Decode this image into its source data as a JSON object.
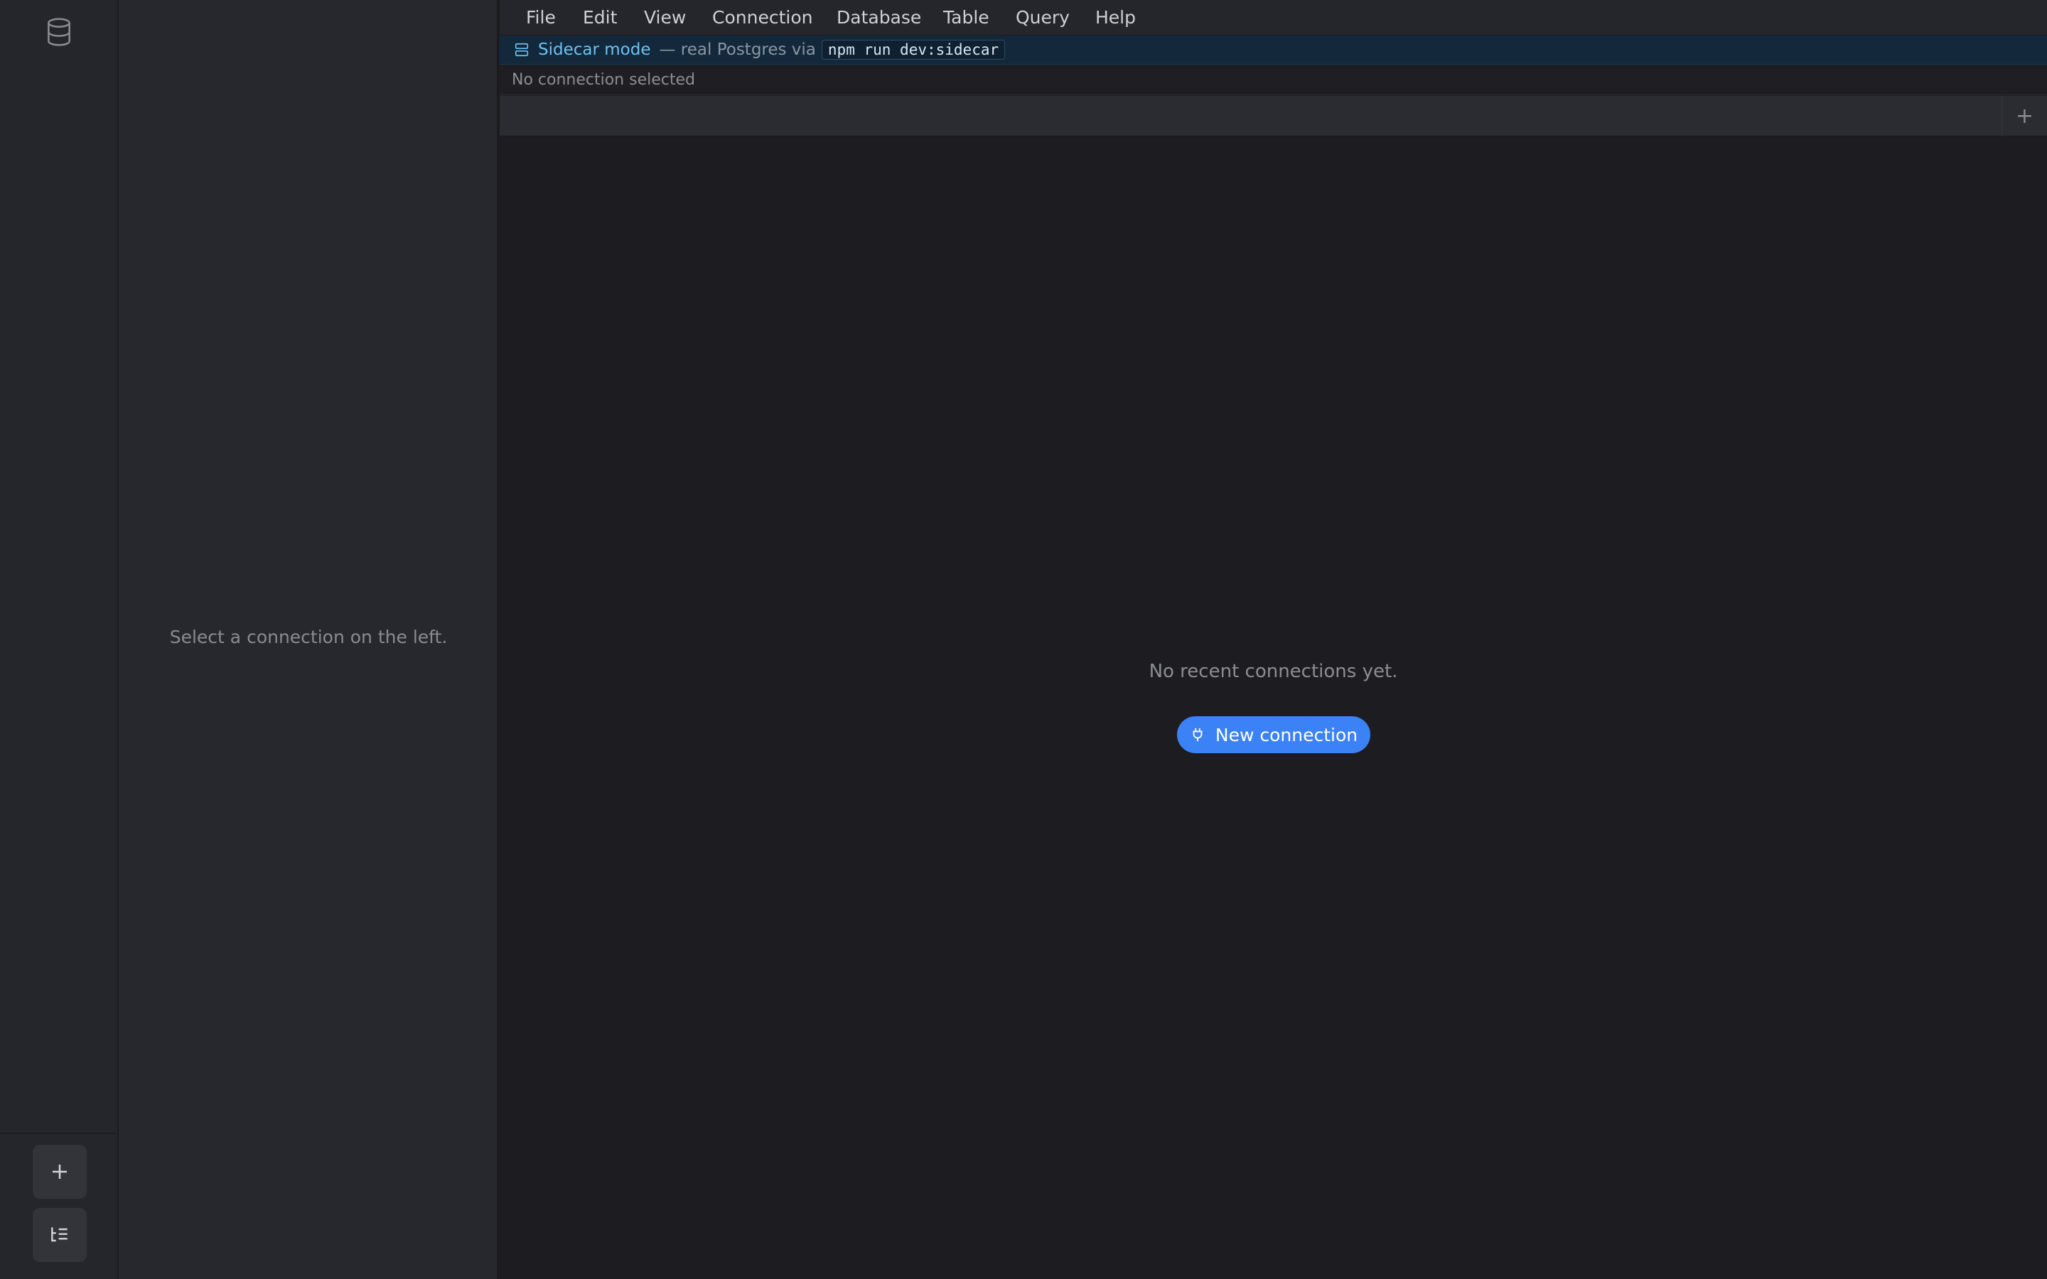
{
  "rail": {
    "icons": [
      "database-icon",
      "plus-icon",
      "tree-list-icon"
    ]
  },
  "explorer": {
    "empty_text": "Select a connection on the left."
  },
  "menubar": {
    "items": [
      "File",
      "Edit",
      "View",
      "Connection",
      "Database",
      "Table",
      "Query",
      "Help"
    ]
  },
  "banner": {
    "mode": "Sidecar mode",
    "description": "— real Postgres via",
    "command": "npm run dev:sidecar"
  },
  "connection_status": "No connection selected",
  "tabbar": {
    "add_label": "+"
  },
  "main": {
    "empty_message": "No recent connections yet.",
    "new_connection_label": "New connection"
  },
  "colors": {
    "accent": "#3b82f6",
    "banner_text": "#6cc2f2",
    "background": "#1d1d21"
  }
}
